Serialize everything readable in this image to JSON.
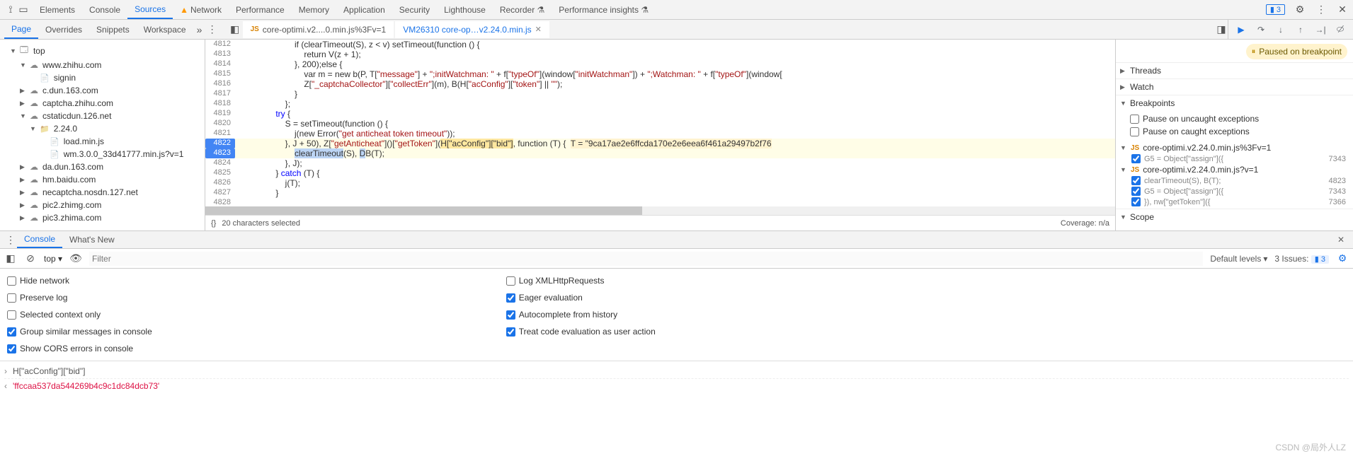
{
  "topTabs": {
    "t0": "Elements",
    "t1": "Console",
    "t2": "Sources",
    "t3": "Network",
    "t4": "Performance",
    "t5": "Memory",
    "t6": "Application",
    "t7": "Security",
    "t8": "Lighthouse",
    "t9": "Recorder",
    "t10": "Performance insights",
    "issues": "3"
  },
  "subTabs": {
    "page": "Page",
    "overrides": "Overrides",
    "snippets": "Snippets",
    "workspace": "Workspace"
  },
  "fileTabs": {
    "f1": "core-optimi.v2....0.min.js%3Fv=1",
    "f2": "VM26310 core-op…v2.24.0.min.js"
  },
  "tree": {
    "top": "top",
    "zhihu": "www.zhihu.com",
    "signin": "signin",
    "cdun": "c.dun.163.com",
    "captcha": "captcha.zhihu.com",
    "cstatic": "cstaticdun.126.net",
    "v2240": "2.24.0",
    "load": "load.min.js",
    "wm": "wm.3.0.0_33d41777.min.js?v=1",
    "dadun": "da.dun.163.com",
    "hmbaidu": "hm.baidu.com",
    "necap": "necaptcha.nosdn.127.net",
    "pic2": "pic2.zhimg.com",
    "pic3": "pic3.zhima.com"
  },
  "gutters": {
    "g4812": "4812",
    "g4813": "4813",
    "g4814": "4814",
    "g4815": "4815",
    "g4816": "4816",
    "g4817": "4817",
    "g4818": "4818",
    "g4819": "4819",
    "g4820": "4820",
    "g4821": "4821",
    "g4822": "4822",
    "g4823": "4823",
    "g4824": "4824",
    "g4825": "4825",
    "g4826": "4826",
    "g4827": "4827",
    "g4828": "4828"
  },
  "code": {
    "l4812": "                        if (clearTimeout(S), z < v) setTimeout(function () {",
    "l4813": "                            return V(z + 1);",
    "l4814": "                        }, 200);else {",
    "l4815a": "                            var m = new b(P, T[",
    "l4815b": "\"message\"",
    "l4815c": "] + ",
    "l4815d": "\";initWatchman: \"",
    "l4815e": " + f[",
    "l4815f": "\"typeOf\"",
    "l4815g": "](window[",
    "l4815h": "\"initWatchman\"",
    "l4815i": "]) + ",
    "l4815j": "\";Watchman: \"",
    "l4815k": " + f[",
    "l4815l": "\"typeOf\"",
    "l4815m": "](window[",
    "l4816a": "                            Z[",
    "l4816b": "\"_captchaCollector\"",
    "l4816c": "][",
    "l4816d": "\"collectErr\"",
    "l4816e": "](m), B(H[",
    "l4816f": "\"acConfig\"",
    "l4816g": "][",
    "l4816h": "\"token\"",
    "l4816i": "] || ",
    "l4816j": "\"\"",
    "l4816k": ");",
    "l4817": "                        }",
    "l4818": "                    };",
    "l4819": "                try {",
    "l4820": "                    S = setTimeout(function () {",
    "l4821a": "                        j(new Error(",
    "l4821b": "\"get anticheat token timeout\"",
    "l4821c": "));",
    "l4822a": "                    }, J + 50), Z[",
    "l4822b": "\"getAnticheat\"",
    "l4822c": "]()[",
    "l4822d": "\"getToken\"",
    "l4822e": "](",
    "l4822f": "H[\"acConfig\"][\"bid\"]",
    "l4822g": ", function (T) {  ",
    "l4822h": "T = \"9ca17ae2e6ffcda170e2e6eea6f461a29497b2f76",
    "l4823a": "                        ",
    "l4823b": "clearTimeout",
    "l4823c": "(S), ",
    "l4823d": "D",
    "l4823e": "B(T);",
    "l4824": "                    }, J);",
    "l4825": "                } catch (T) {",
    "l4826": "                    j(T);",
    "l4827": "                }",
    "l4828": ""
  },
  "codeStatus": {
    "braces": "{}",
    "chars": "20 characters selected",
    "coverage": "Coverage: n/a"
  },
  "pauseBanner": "Paused on breakpoint",
  "sections": {
    "threads": "Threads",
    "watch": "Watch",
    "breakpoints": "Breakpoints",
    "scope": "Scope"
  },
  "bpOptions": {
    "uncaught": "Pause on uncaught exceptions",
    "caught": "Pause on caught exceptions"
  },
  "bpGroups": {
    "g1file": "core-optimi.v2.24.0.min.js%3Fv=1",
    "g1r1": "G5 = Object[\"assign\"]({",
    "g1r1ln": "7343",
    "g2file": "core-optimi.v2.24.0.min.js?v=1",
    "g2r1": "clearTimeout(S), B(T);",
    "g2r1ln": "4823",
    "g2r2": "G5 = Object[\"assign\"]({",
    "g2r2ln": "7343",
    "g2r3": "}), nw[\"getToken\"]({",
    "g2r3ln": "7366"
  },
  "drawer": {
    "console": "Console",
    "whatsnew": "What's New"
  },
  "consoleToolbar": {
    "top": "top",
    "filterPh": "Filter",
    "levels": "Default levels",
    "issues": "3 Issues:",
    "issuesN": "3"
  },
  "settings": {
    "hideNet": "Hide network",
    "presLog": "Preserve log",
    "selCtx": "Selected context only",
    "groupSim": "Group similar messages in console",
    "showCors": "Show CORS errors in console",
    "logXhr": "Log XMLHttpRequests",
    "eager": "Eager evaluation",
    "autoHist": "Autocomplete from history",
    "treatEval": "Treat code evaluation as user action"
  },
  "consoleIO": {
    "in": "H[\"acConfig\"][\"bid\"]",
    "out": "'ffccaa537da544269b4c9c1dc84dcb73'"
  },
  "watermark": "CSDN @局外人LZ"
}
